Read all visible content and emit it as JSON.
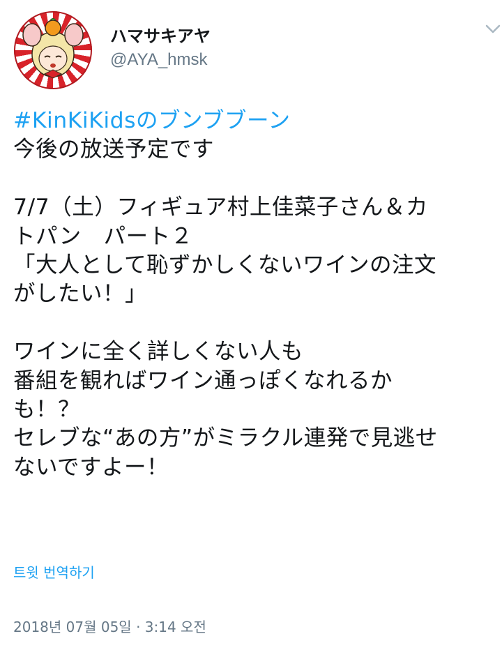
{
  "author": {
    "display_name": "ハマサキアヤ",
    "handle": "@AYA_hmsk"
  },
  "icons": {
    "menu": "chevron-down-icon",
    "avatar": "profile-avatar"
  },
  "colors": {
    "link": "#1da1f2",
    "text": "#14171a",
    "secondary": "#657786",
    "avatar_red": "#d8232a"
  },
  "tweet": {
    "hashtag": "#KinKiKidsのブンブブーン",
    "lines": [
      "今後の放送予定です",
      "",
      "7/7（土）フィギュア村上佳菜子さん＆カ",
      "トパン　パート２",
      "「大人として恥ずかしくないワインの注文",
      "がしたい！」",
      "",
      "ワインに全く詳しくない人も",
      "番組を観ればワイン通っぽくなれるか",
      "も！？",
      "セレブな“あの方”がミラクル連発で見逃せ",
      "ないですよー！"
    ]
  },
  "translate_label": "트윗 번역하기",
  "timestamp": "2018년 07월 05일 · 3:14 오전"
}
